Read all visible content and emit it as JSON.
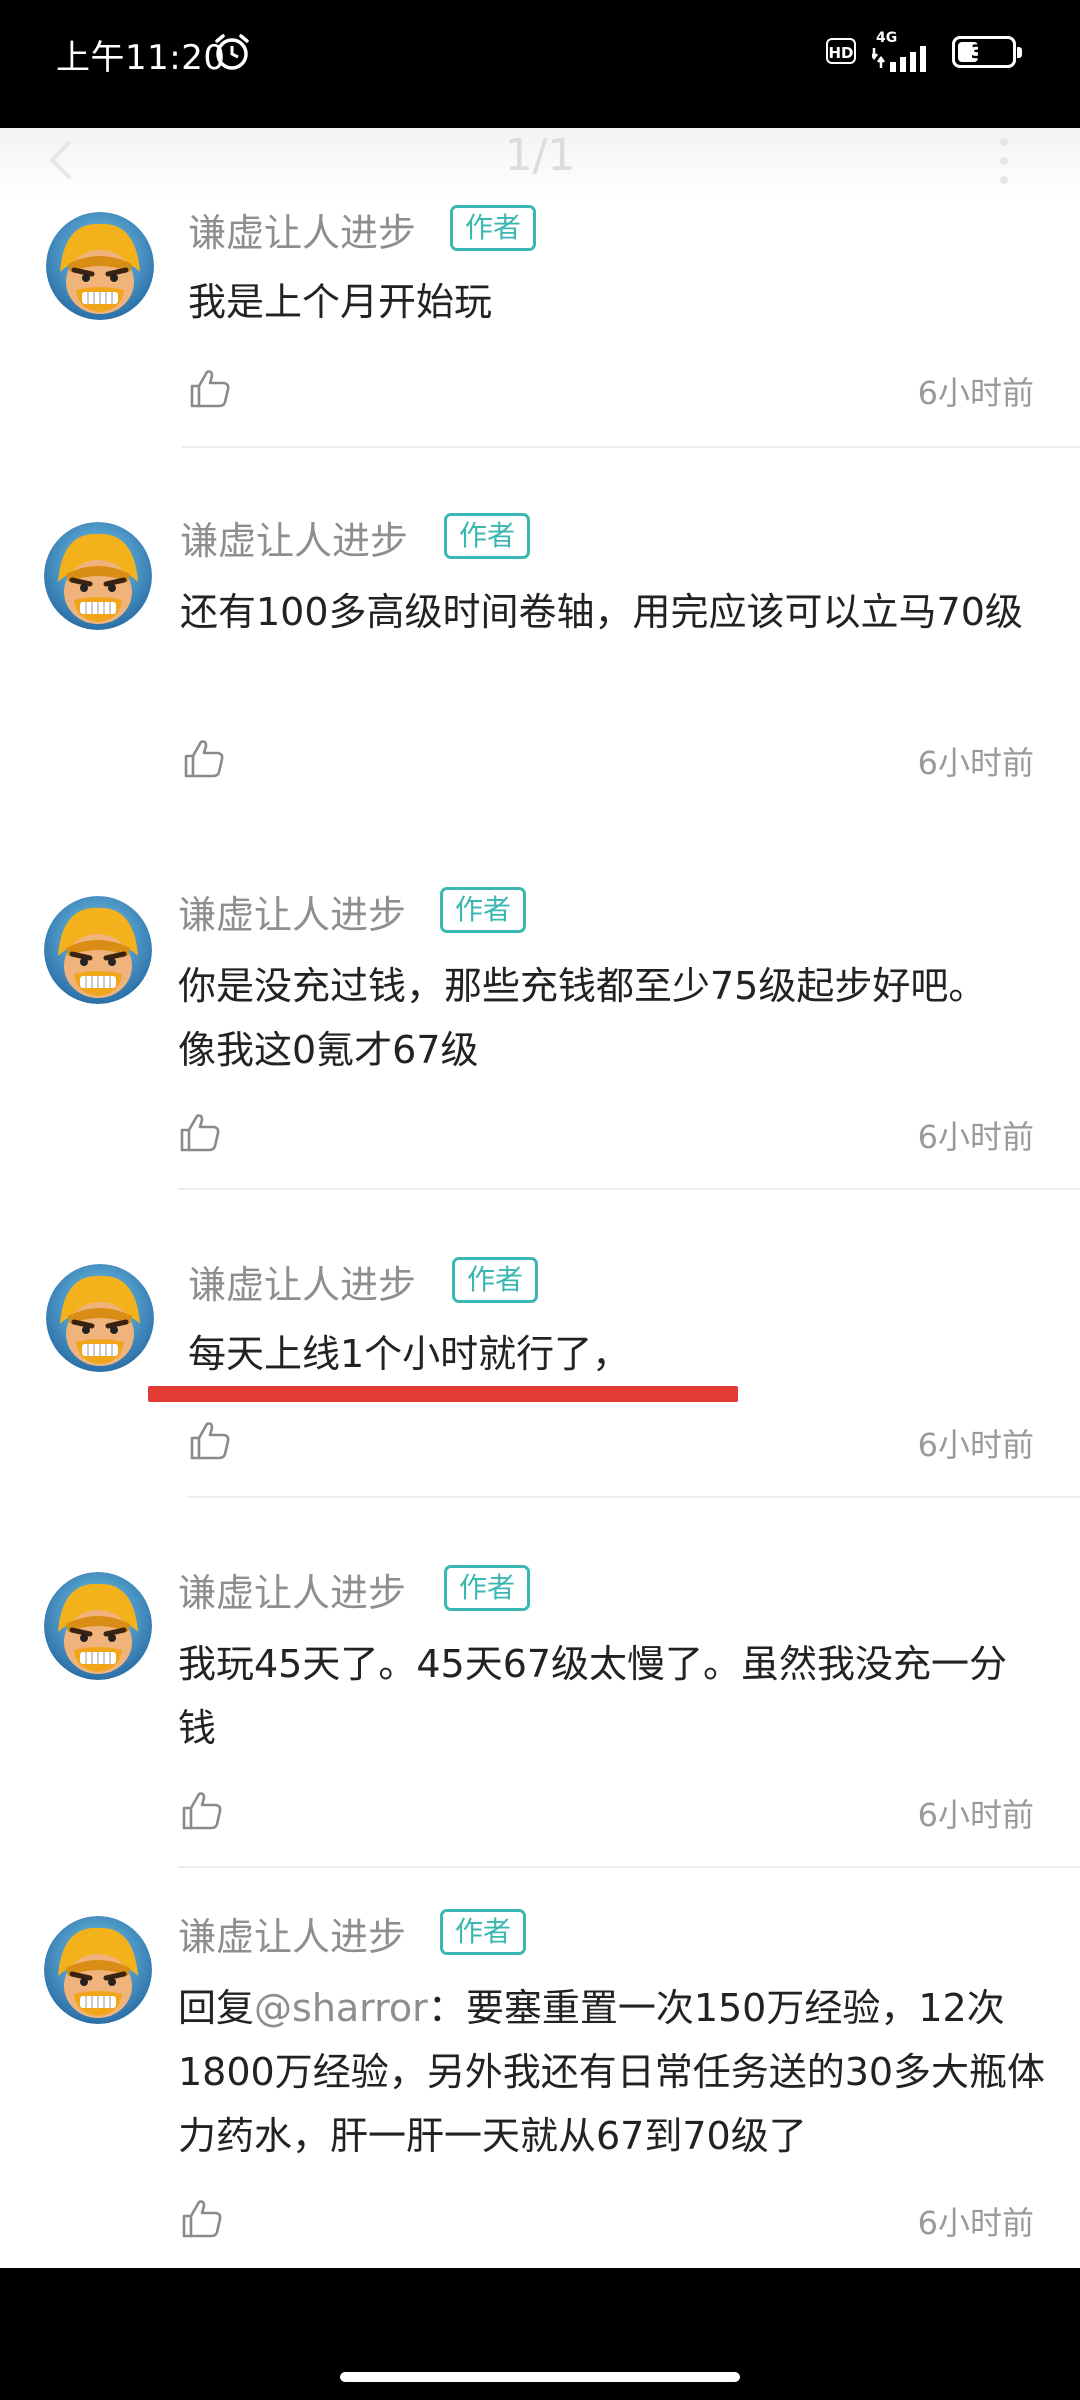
{
  "status_bar": {
    "time": "上午11:20",
    "network": "4G",
    "battery": "38",
    "battery_level": 0.38
  },
  "header": {
    "page_indicator": "1/1"
  },
  "comments": [
    {
      "username": "谦虚让人进步",
      "badge": "作者",
      "text": "我是上个月开始玩",
      "time": "6小时前"
    },
    {
      "username": "谦虚让人进步",
      "badge": "作者",
      "text": "还有100多高级时间卷轴，用完应该可以立马70级",
      "time": "6小时前"
    },
    {
      "username": "谦虚让人进步",
      "badge": "作者",
      "text": "你是没充过钱，那些充钱都至少75级起步好吧。像我这0氪才67级",
      "time": "6小时前"
    },
    {
      "username": "谦虚让人进步",
      "badge": "作者",
      "text": "每天上线1个小时就行了，",
      "time": "6小时前"
    },
    {
      "username": "谦虚让人进步",
      "badge": "作者",
      "text": "我玩45天了。45天67级太慢了。虽然我没充一分钱",
      "time": "6小时前"
    },
    {
      "username": "谦虚让人进步",
      "badge": "作者",
      "reply_prefix": "回复",
      "mention": "@sharror",
      "text": "：要塞重置一次150万经验，12次1800万经验，另外我还有日常任务送的30多大瓶体力药水，肝一肝一天就从67到70级了",
      "time": "6小时前"
    }
  ],
  "colors": {
    "badge": "#39b7b0",
    "highlight": "#e23a35",
    "mention": "#8e8e8e"
  },
  "icons": {
    "like": "thumbs-up-icon",
    "avatar": "barbarian-avatar"
  }
}
